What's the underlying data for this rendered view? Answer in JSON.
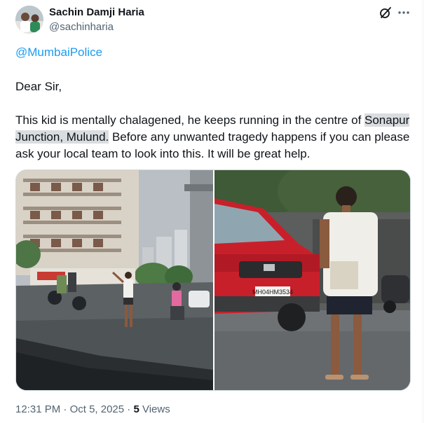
{
  "author": {
    "name": "Sachin Damji Haria",
    "handle": "@sachinharia"
  },
  "post": {
    "mention": "@MumbaiPolice",
    "greeting": "Dear Sir,",
    "body_pre": "This kid is mentally chalagened, he keeps running in the centre of ",
    "body_highlight": "Sonapur Junction, Mulund.",
    "body_post": " Before any unwanted tragedy happens if you can please ask your local team to look into this. It will be great help."
  },
  "photos": {
    "left": {
      "scene": "rainy street junction with buildings, scooters and a kid on the road",
      "plate_text": ""
    },
    "right": {
      "scene": "kid standing on road in front of a red car",
      "plate_text": "MH04HM3534"
    }
  },
  "meta": {
    "time": "12:31 PM",
    "separator": "·",
    "date": "Oct 5, 2025",
    "views_count": "5",
    "views_label": "Views"
  },
  "icons": {
    "grok": "grok-icon",
    "more": "more-icon"
  },
  "colors": {
    "link": "#1d9bf0",
    "secondary_text": "#536471",
    "car_red": "#c8202b"
  }
}
